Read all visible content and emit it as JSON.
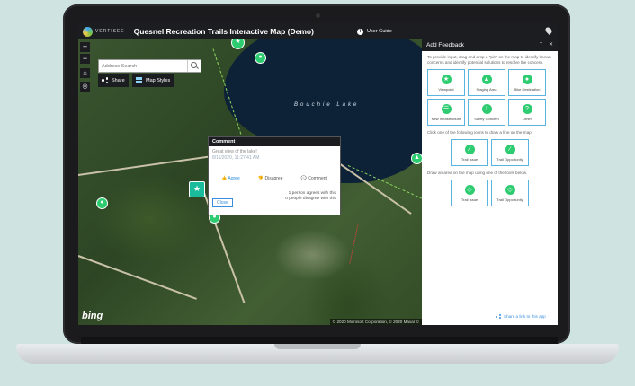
{
  "app": {
    "brand": "VERTISEE",
    "title": "Quesnel Recreation Trails Interactive Map (Demo)",
    "user_guide": "User Guide"
  },
  "map": {
    "zoom_in": "+",
    "zoom_out": "−",
    "search_placeholder": "Address Search",
    "share_label": "Share",
    "styles_label": "Map Styles",
    "lake_label": "Bouchie Lake",
    "bing_logo": "bing",
    "copyright": "© 2020 Microsoft Corporation, © 2020 Maxar ©"
  },
  "popup": {
    "header": "Comment",
    "text": "Great view of the lake!",
    "date": "8/11/2020, 11:27:41 AM",
    "agree": "Agree",
    "disagree": "Disagree",
    "comment": "Comment",
    "agree_stat": "1 person agrees with this",
    "disagree_stat": "0 people disagree with this",
    "close": "Close"
  },
  "panel": {
    "title": "Add Feedback",
    "intro": "To provide input, drag and drop a \"pin\" on the map to identify known concerns and identify potential solutions to resolve the concern.",
    "point_items": [
      "Viewpoint",
      "Staging Area",
      "Bike Destination",
      "New Infrastructure",
      "Safety Concern",
      "Other"
    ],
    "line_instr": "Click one of the following icons to draw a line on the map:",
    "line_items": [
      "Trail Issue",
      "Trail Opportunity"
    ],
    "area_instr": "Draw an area on the map using one of the tools below.",
    "area_items": [
      "Trail Issue",
      "Trail Opportunity"
    ],
    "share_link": "Share a link to this app"
  },
  "colors": {
    "accent": "#2ecc71",
    "panel_border": "#5ab4e0",
    "titlebar": "#1c1d20"
  }
}
